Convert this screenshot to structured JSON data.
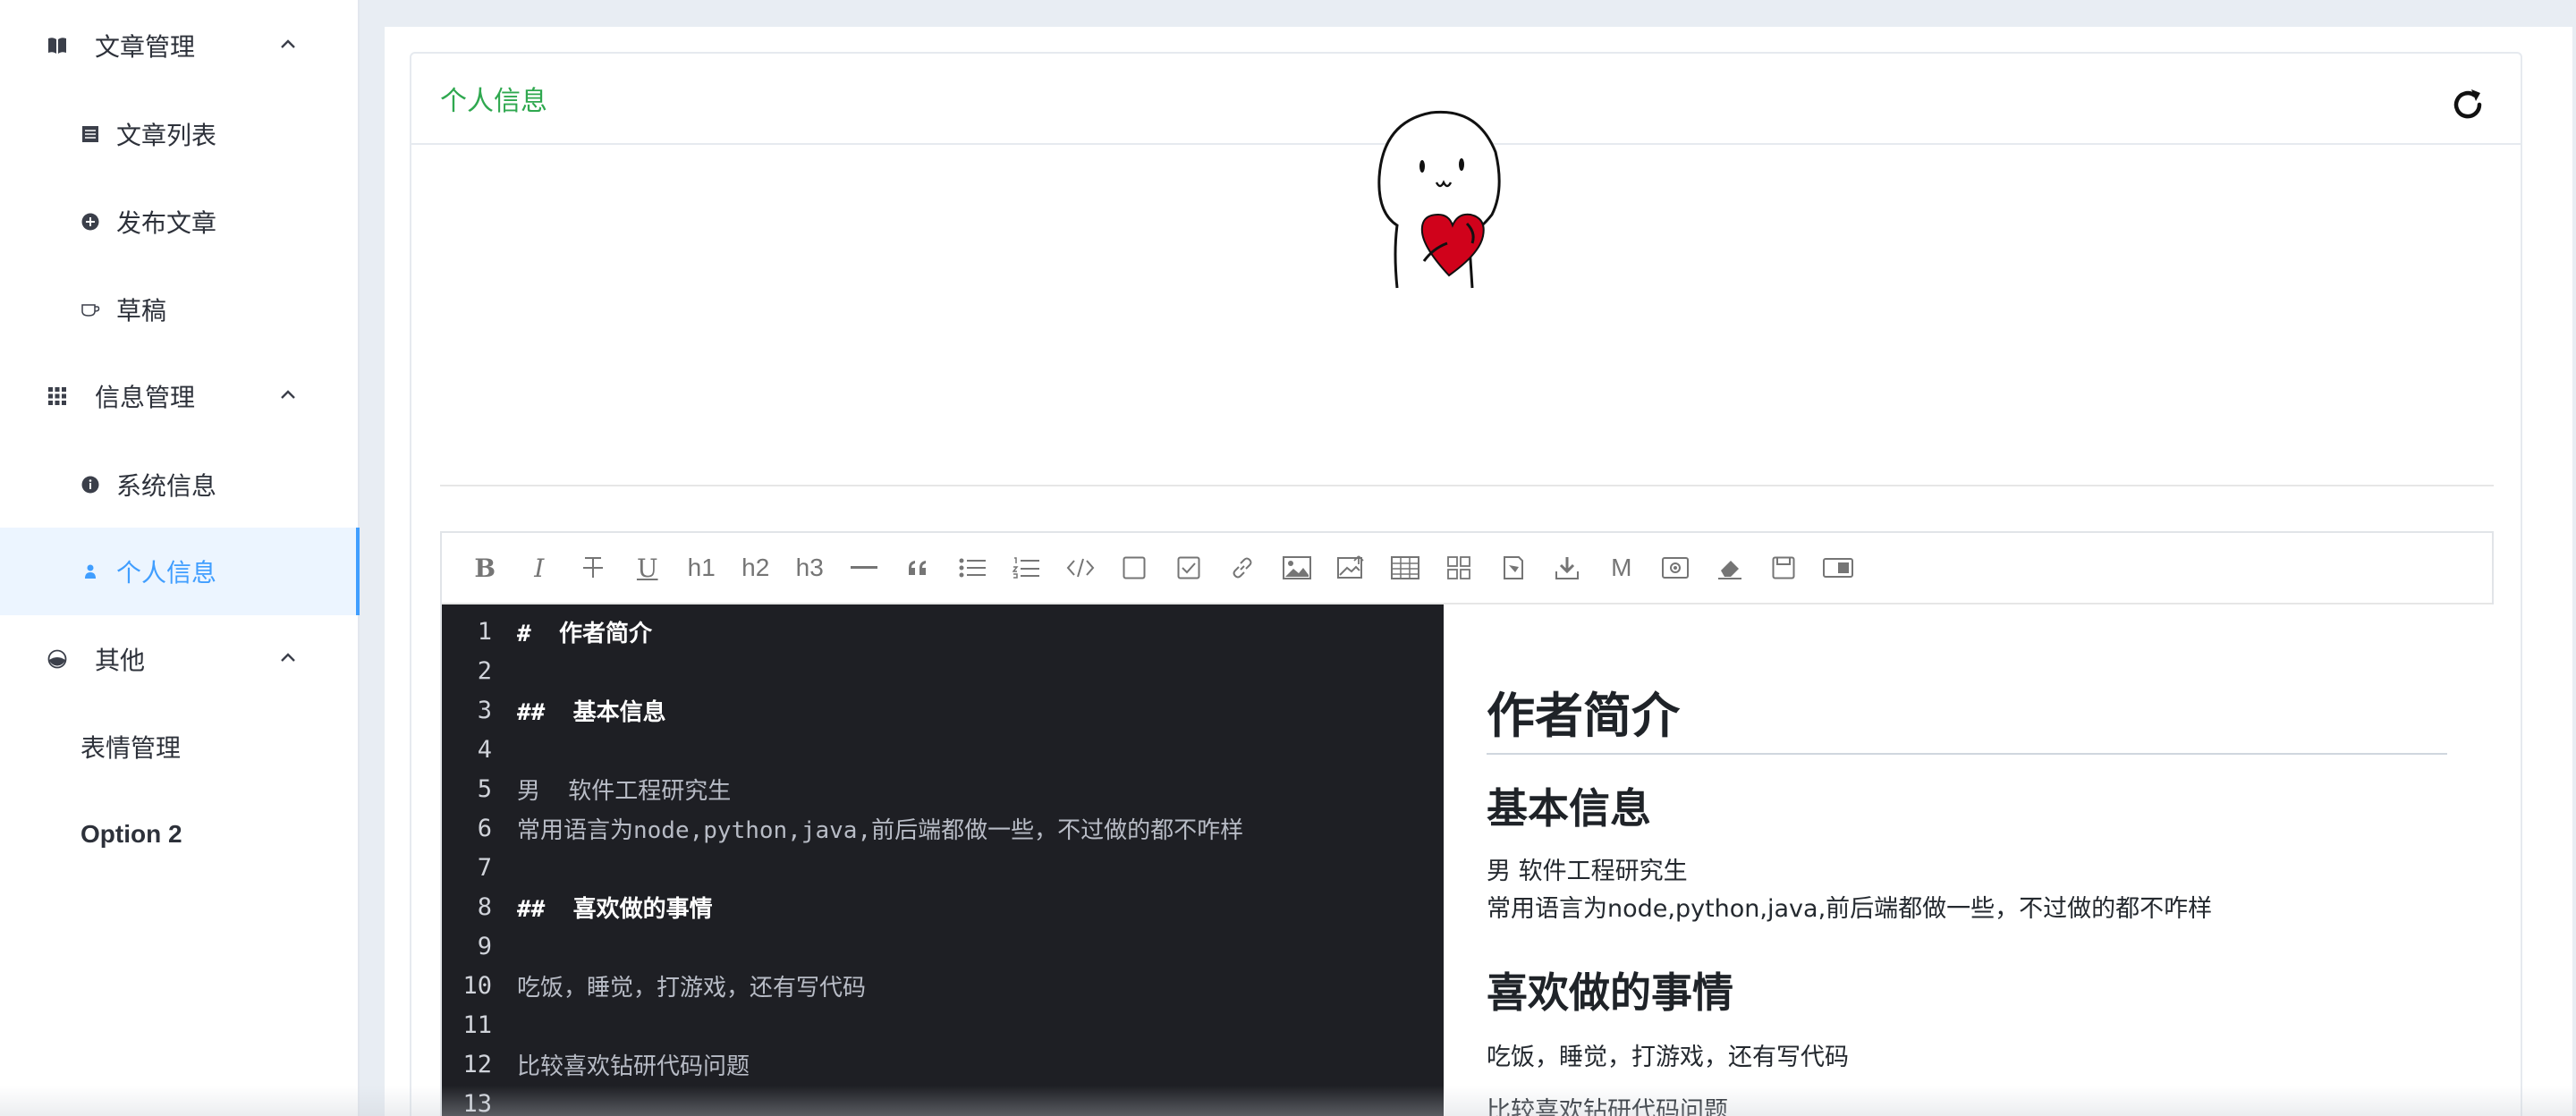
{
  "sidebar": {
    "groups": [
      {
        "label": "文章管理",
        "icon": "book-icon",
        "items": [
          {
            "label": "文章列表",
            "icon": "list-icon"
          },
          {
            "label": "发布文章",
            "icon": "plus-circle-icon"
          },
          {
            "label": "草稿",
            "icon": "cup-icon"
          }
        ]
      },
      {
        "label": "信息管理",
        "icon": "grid-icon",
        "items": [
          {
            "label": "系统信息",
            "icon": "info-icon"
          },
          {
            "label": "个人信息",
            "icon": "user-icon"
          }
        ]
      },
      {
        "label": "其他",
        "icon": "palette-icon",
        "items": [
          {
            "label": "表情管理"
          },
          {
            "label": "Option 2"
          }
        ]
      }
    ],
    "active_item": "个人信息",
    "active_color": "#409eff"
  },
  "card": {
    "title": "个人信息",
    "title_color": "#2fa84f",
    "refresh_icon": "refresh-icon",
    "avatar": "heart-character-avatar"
  },
  "editor": {
    "toolbar": [
      "B",
      "I",
      "strikethrough-icon",
      "U",
      "h1",
      "h2",
      "h3",
      "hr-icon",
      "quote-icon",
      "unordered-list-icon",
      "ordered-list-icon",
      "code-icon",
      "checkbox-empty-icon",
      "checkbox-checked-icon",
      "link-icon",
      "image-icon",
      "image-upload-icon",
      "table-icon",
      "grid-icon",
      "clip-icon",
      "download-icon",
      "M",
      "preview-eye-icon",
      "eraser-icon",
      "save-icon",
      "toggle-icon"
    ],
    "toolbar_labels": {
      "bold": "B",
      "italic": "I",
      "underline": "U",
      "h1": "h1",
      "h2": "h2",
      "h3": "h3",
      "markdown": "M"
    },
    "code_lines": [
      {
        "n": "1",
        "text": "#  作者简介"
      },
      {
        "n": "2",
        "text": ""
      },
      {
        "n": "3",
        "text": "##  基本信息"
      },
      {
        "n": "4",
        "text": ""
      },
      {
        "n": "5",
        "text": "男  软件工程研究生"
      },
      {
        "n": "6",
        "text": "常用语言为node,python,java,前后端都做一些，不过做的都不咋样"
      },
      {
        "n": "7",
        "text": ""
      },
      {
        "n": "8",
        "text": "##  喜欢做的事情"
      },
      {
        "n": "9",
        "text": ""
      },
      {
        "n": "10",
        "text": "吃饭，睡觉，打游戏，还有写代码"
      },
      {
        "n": "11",
        "text": ""
      },
      {
        "n": "12",
        "text": "比较喜欢钻研代码问题"
      },
      {
        "n": "13",
        "text": ""
      }
    ],
    "preview": {
      "h1": "作者简介",
      "h2_basic": "基本信息",
      "p_gender": "男 软件工程研究生",
      "p_lang": "常用语言为node,python,java,前后端都做一些，不过做的都不咋样",
      "h2_hobby": "喜欢做的事情",
      "p_hobby": "吃饭，睡觉，打游戏，还有写代码",
      "p_study": "比较喜欢钻研代码问题"
    }
  }
}
